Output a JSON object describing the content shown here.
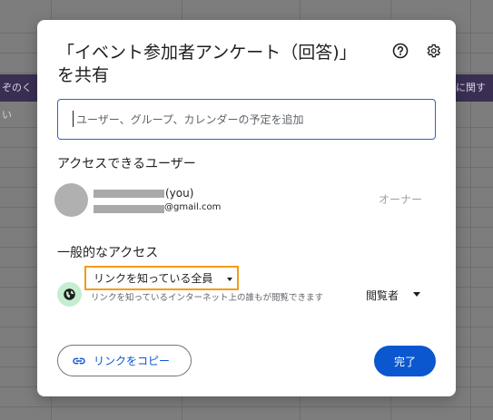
{
  "background": {
    "left_text": "ぞのくい",
    "right_text": "に関す"
  },
  "dialog": {
    "title": "「イベント参加者アンケート（回答)」を共有",
    "help_icon": "help-circle-icon",
    "settings_icon": "gear-icon",
    "share_input": {
      "placeholder": "ユーザー、グループ、カレンダーの予定を追加",
      "value": ""
    },
    "users_section_label": "アクセスできるユーザー",
    "user": {
      "name_suffix": "(you)",
      "email_suffix": "@gmail.com",
      "role": "オーナー"
    },
    "general_section_label": "一般的なアクセス",
    "general_access": {
      "icon": "globe-icon",
      "selected": "リンクを知っている全員",
      "description": "リンクを知っているインターネット上の誰もが閲覧できます",
      "role": "閲覧者"
    },
    "copy_link_label": "リンクをコピー",
    "done_label": "完了"
  },
  "colors": {
    "accent": "#0b57d0",
    "highlight_border": "#f59b14",
    "globe_bg": "#c4eed0"
  }
}
